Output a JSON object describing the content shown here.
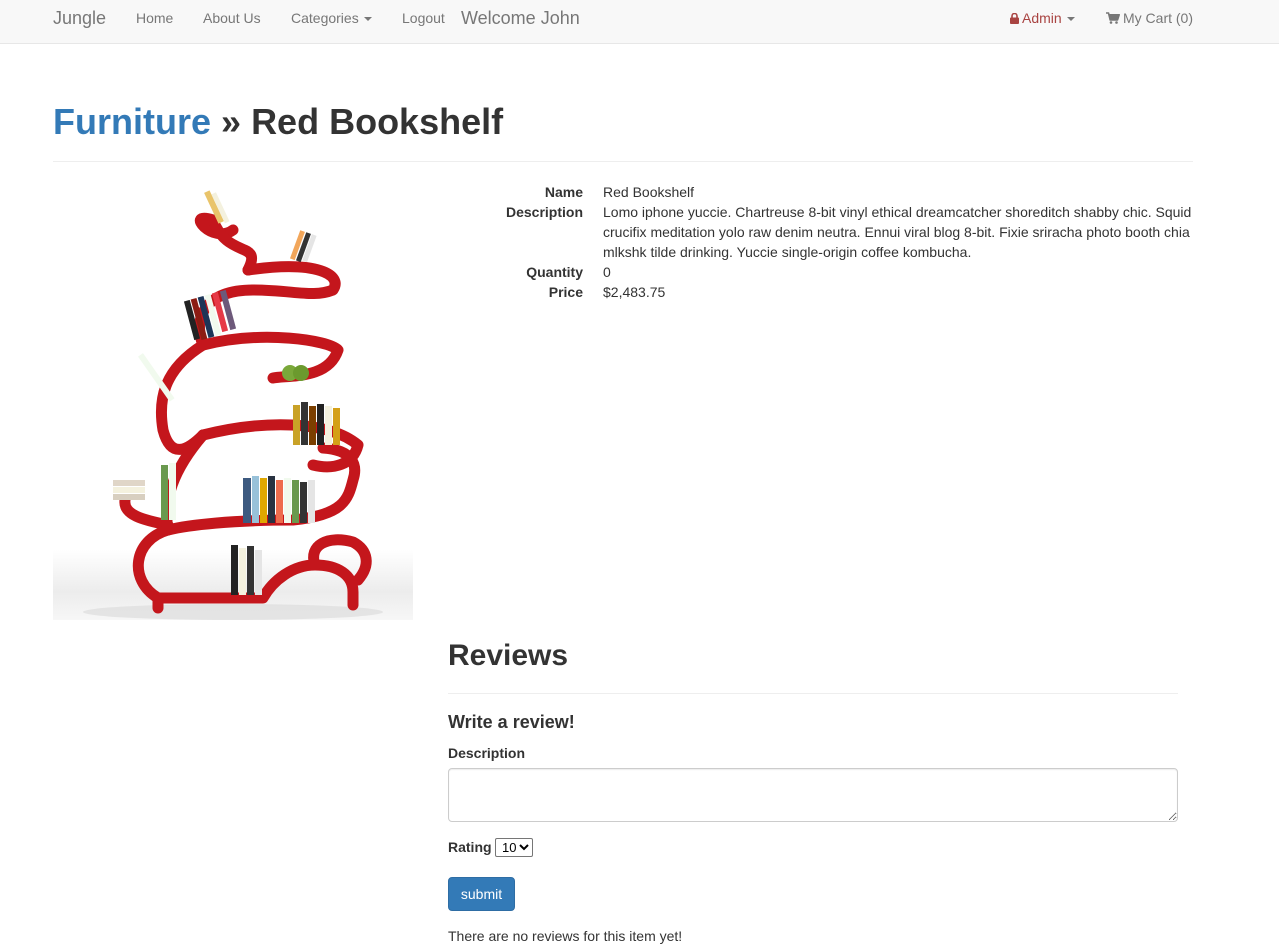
{
  "navbar": {
    "brand": "Jungle",
    "home": "Home",
    "about": "About Us",
    "categories": "Categories",
    "logout": "Logout",
    "welcome": "Welcome John",
    "admin": "Admin",
    "cart": "My Cart (0)"
  },
  "breadcrumb": {
    "category": "Furniture",
    "separator": "»",
    "product": "Red Bookshelf"
  },
  "product": {
    "fields": [
      {
        "label": "Name",
        "value": "Red Bookshelf"
      },
      {
        "label": "Description",
        "value": "Lomo iphone yuccie. Chartreuse 8-bit vinyl ethical dreamcatcher shoreditch shabby chic. Squid crucifix meditation yolo raw denim neutra. Ennui viral blog 8-bit. Fixie sriracha photo booth chia mlkshk tilde drinking. Yuccie single-origin coffee kombucha."
      },
      {
        "label": "Quantity",
        "value": "0"
      },
      {
        "label": "Price",
        "value": "$2,483.75"
      }
    ]
  },
  "reviews": {
    "title": "Reviews",
    "write_title": "Write a review!",
    "description_label": "Description",
    "description_value": "",
    "rating_label": "Rating",
    "rating_selected": "10",
    "submit_label": "submit",
    "empty_message": "There are no reviews for this item yet!"
  },
  "colors": {
    "link": "#337ab7",
    "admin": "#a94442",
    "primary_button": "#337ab7",
    "shelf_red": "#c4161c"
  },
  "icons": {
    "admin": "lock-icon",
    "cart": "shopping-cart-icon"
  }
}
